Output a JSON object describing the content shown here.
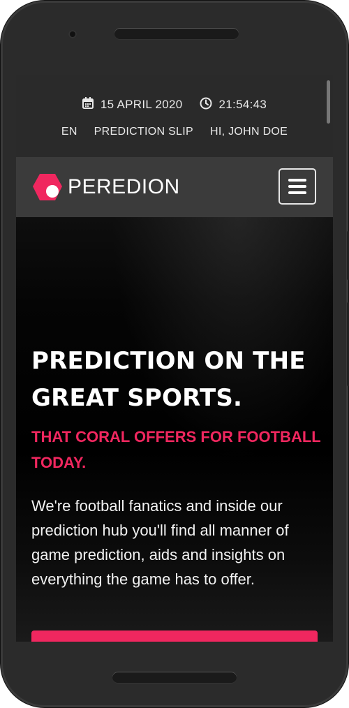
{
  "topbar": {
    "date": "15 APRIL 2020",
    "time": "21:54:43",
    "language": "EN",
    "prediction_slip": "PREDICTION SLIP",
    "greeting": "HI, JOHN DOE"
  },
  "navbar": {
    "brand": "PEREDION",
    "brand_color": "#f0275f"
  },
  "hero": {
    "title": "PREDICTION ON THE GREAT SPORTS.",
    "subtitle": "THAT CORAL OFFERS FOR FOOTBALL TODAY.",
    "body": "We're football fanatics and inside our prediction hub you'll find all manner of game prediction, aids and insights on everything the game has to offer."
  },
  "icons": {
    "calendar": "calendar-icon",
    "clock": "clock-icon",
    "menu": "hamburger-icon"
  },
  "colors": {
    "accent": "#f0275f",
    "topbar_bg": "#2a2a2a",
    "navbar_bg": "#3b3b3b"
  }
}
